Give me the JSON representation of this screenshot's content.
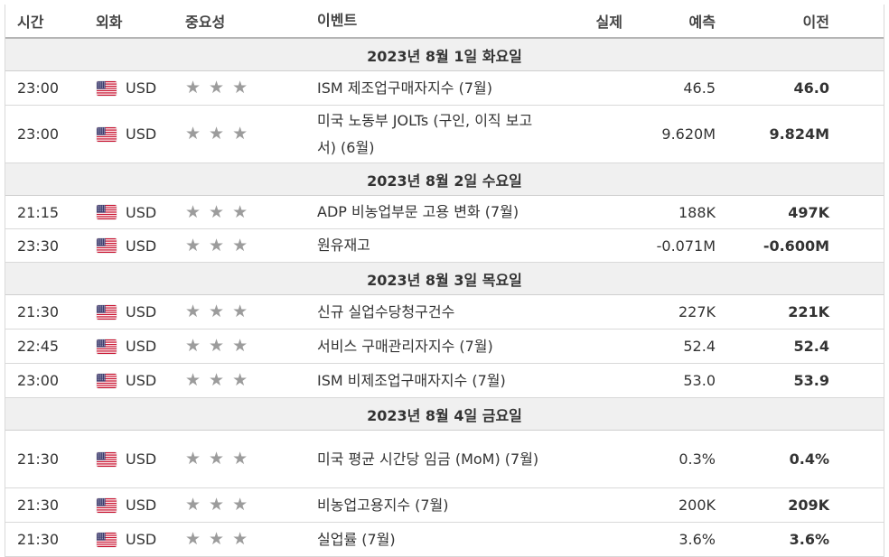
{
  "headers": {
    "time": "시간",
    "currency": "외화",
    "importance": "중요성",
    "event": "이벤트",
    "actual": "실제",
    "forecast": "예측",
    "previous": "이전"
  },
  "colors": {
    "date_row_bg": "#f0f0f0",
    "star": "#9c9c9c",
    "border": "#d9d9d9"
  },
  "icons": {
    "flag": "us-flag-icon",
    "star": "star-icon"
  },
  "groups": [
    {
      "date": "2023년 8월 1일 화요일",
      "rows": [
        {
          "time": "23:00",
          "currency": "USD",
          "event": "ISM 제조업구매자지수 (7월)",
          "actual": "",
          "forecast": "46.5",
          "previous": "46.0"
        },
        {
          "time": "23:00",
          "currency": "USD",
          "event": "미국 노동부 JOLTs (구인, 이직 보고서) (6월)",
          "actual": "",
          "forecast": "9.620M",
          "previous": "9.824M"
        }
      ]
    },
    {
      "date": "2023년 8월 2일 수요일",
      "rows": [
        {
          "time": "21:15",
          "currency": "USD",
          "event": "ADP 비농업부문 고용 변화 (7월)",
          "actual": "",
          "forecast": "188K",
          "previous": "497K"
        },
        {
          "time": "23:30",
          "currency": "USD",
          "event": "원유재고",
          "actual": "",
          "forecast": "-0.071M",
          "previous": "-0.600M"
        }
      ]
    },
    {
      "date": "2023년 8월 3일 목요일",
      "rows": [
        {
          "time": "21:30",
          "currency": "USD",
          "event": "신규 실업수당청구건수",
          "actual": "",
          "forecast": "227K",
          "previous": "221K"
        },
        {
          "time": "22:45",
          "currency": "USD",
          "event": "서비스 구매관리자지수 (7월)",
          "actual": "",
          "forecast": "52.4",
          "previous": "52.4"
        },
        {
          "time": "23:00",
          "currency": "USD",
          "event": "ISM 비제조업구매자지수 (7월)",
          "actual": "",
          "forecast": "53.0",
          "previous": "53.9"
        }
      ]
    },
    {
      "date": "2023년 8월 4일 금요일",
      "rows": [
        {
          "time": "21:30",
          "currency": "USD",
          "event": "미국 평균 시간당 임금 (MoM) (7월)",
          "actual": "",
          "forecast": "0.3%",
          "previous": "0.4%"
        },
        {
          "time": "21:30",
          "currency": "USD",
          "event": "비농업고용지수 (7월)",
          "actual": "",
          "forecast": "200K",
          "previous": "209K"
        },
        {
          "time": "21:30",
          "currency": "USD",
          "event": "실업률 (7월)",
          "actual": "",
          "forecast": "3.6%",
          "previous": "3.6%"
        }
      ]
    }
  ]
}
